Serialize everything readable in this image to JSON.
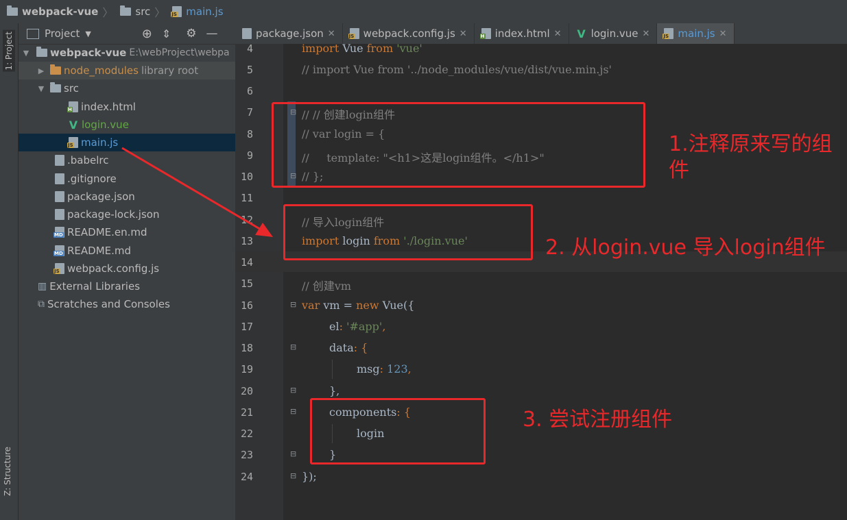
{
  "breadcrumb": {
    "project": "webpack-vue",
    "folder": "src",
    "file": "main.js"
  },
  "sidebar": {
    "tab_project": "1: Project",
    "tab_structure": "Z: Structure"
  },
  "project_panel": {
    "title": "Project",
    "root_name": "webpack-vue",
    "root_path": "E:\\webProject\\webpa",
    "items": [
      {
        "name": "node_modules",
        "suffix": "library root"
      },
      {
        "name": "src"
      },
      {
        "name": "index.html"
      },
      {
        "name": "login.vue"
      },
      {
        "name": "main.js"
      },
      {
        "name": ".babelrc"
      },
      {
        "name": ".gitignore"
      },
      {
        "name": "package.json"
      },
      {
        "name": "package-lock.json"
      },
      {
        "name": "README.en.md"
      },
      {
        "name": "README.md"
      },
      {
        "name": "webpack.config.js"
      },
      {
        "name": "External Libraries"
      },
      {
        "name": "Scratches and Consoles"
      }
    ]
  },
  "tabs": [
    {
      "label": "package.json"
    },
    {
      "label": "webpack.config.js"
    },
    {
      "label": "index.html"
    },
    {
      "label": "login.vue"
    },
    {
      "label": "main.js"
    }
  ],
  "code": {
    "line_numbers": [
      "4",
      "5",
      "6",
      "7",
      "8",
      "9",
      "10",
      "11",
      "12",
      "13",
      "14",
      "15",
      "16",
      "17",
      "18",
      "19",
      "20",
      "21",
      "22",
      "23",
      "24"
    ],
    "l4": {
      "kw1": "import",
      "t1": " Vue ",
      "kw2": "from",
      "s": " 'vue'"
    },
    "l5": "// import Vue from '../node_modules/vue/dist/vue.min.js'",
    "l7": "// // 创建login组件",
    "l8": "// var login = {",
    "l9": "//     template: \"<h1>这是login组件。</h1>\"",
    "l10": "// };",
    "l12": "// 导入login组件",
    "l13": {
      "kw1": "import",
      "t1": " login ",
      "kw2": "from",
      "s": " './login.vue'"
    },
    "l15": "// 创建vm",
    "l16": {
      "kw1": "var",
      "t1": " vm = ",
      "kw2": "new",
      "t2": " Vue({"
    },
    "l17": {
      "p": "el",
      "t": ": ",
      "s": "'#app'",
      "e": ","
    },
    "l18": {
      "p": "data",
      "t": ": {"
    },
    "l19": {
      "p": "msg",
      "t": ": ",
      "n": "123",
      "e": ","
    },
    "l20": "},",
    "l21": {
      "p": "components",
      "t": ": {"
    },
    "l22": "login",
    "l23": "}",
    "l24": "});"
  },
  "annotations": {
    "note1": "1.注释原来写的组件",
    "note2": "2. 从login.vue 导入login组件",
    "note3": "3. 尝试注册组件"
  },
  "colors": {
    "annotation": "#e8282a",
    "keyword": "#cc7832",
    "string": "#6a8759",
    "comment": "#808080"
  }
}
